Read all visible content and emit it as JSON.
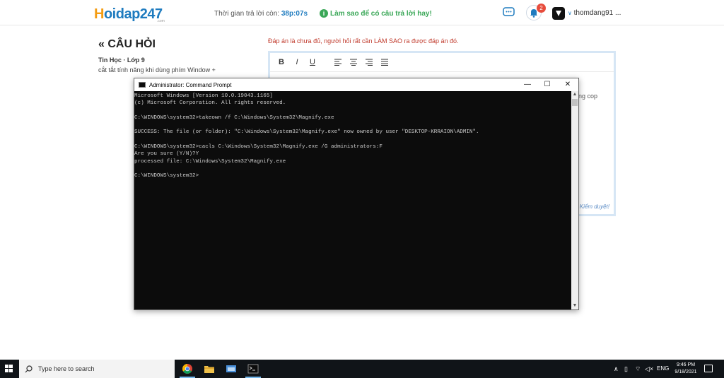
{
  "header": {
    "logo_main": "oidap247",
    "logo_lead": "H",
    "logo_sub": ".com",
    "timer_label": "Thời gian trả lời còn: ",
    "timer_value": "38p:07s",
    "tip_text": "Làm sao để có câu trả lời hay!",
    "notification_count": "2",
    "username": "thomdang91 ..."
  },
  "question": {
    "title": "CÂU HỎI",
    "subject": "Tin Học · Lớp 9",
    "text": "cắt tắt tính năng khi dùng phím Window +"
  },
  "answer": {
    "warning": "Đáp án là chưa đủ, người hỏi rất cần LÀM SAO ra được đáp án đó.",
    "toolbar": {
      "bold": "B",
      "italic": "I",
      "underline": "U"
    },
    "text_fragment": "ng cop",
    "moderation_note": "Kiểm duyệt!"
  },
  "cmd": {
    "title": "Administrator: Command Prompt",
    "lines": [
      "Microsoft Windows [Version 10.0.19043.1165]",
      "(c) Microsoft Corporation. All rights reserved.",
      "",
      "C:\\WINDOWS\\system32>takeown /f C:\\Windows\\System32\\Magnify.exe",
      "",
      "SUCCESS: The file (or folder): \"C:\\Windows\\System32\\Magnify.exe\" now owned by user \"DESKTOP-KRRAION\\ADMIN\".",
      "",
      "C:\\WINDOWS\\system32>cacls C:\\Windows\\System32\\Magnify.exe /G administrators:F",
      "Are you sure (Y/N)?Y",
      "processed file: C:\\Windows\\System32\\Magnify.exe",
      "",
      "C:\\WINDOWS\\system32>"
    ]
  },
  "taskbar": {
    "search_placeholder": "Type here to search",
    "language": "ENG",
    "time": "9:46 PM",
    "date": "9/18/2021"
  },
  "colors": {
    "brand_orange": "#f39c12",
    "brand_blue": "#1e7bbf",
    "warning_red": "#c0392b",
    "taskbar_bg": "#101418"
  }
}
